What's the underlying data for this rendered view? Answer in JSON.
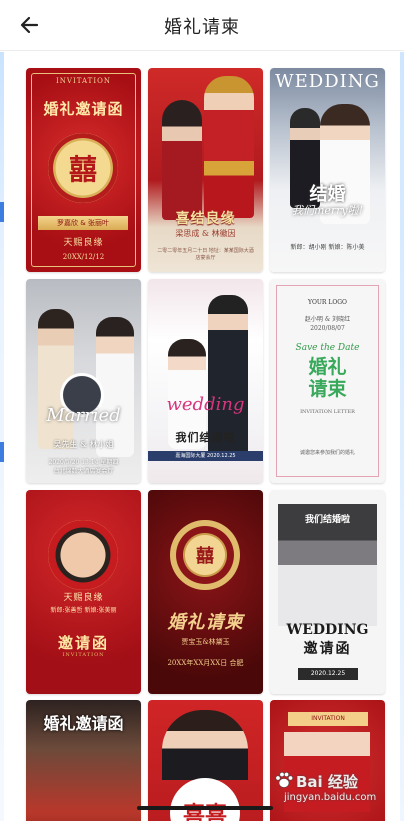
{
  "header": {
    "title": "婚礼请柬",
    "back_icon": "arrow-left-icon"
  },
  "colors": {
    "primary_red": "#b01a1e",
    "gold": "#f3d08d",
    "green": "#38a85a"
  },
  "cards": [
    {
      "invitation": "INVITATION",
      "title": "婚礼邀请函",
      "emblem": "囍",
      "names": "罗嘉欣 & 张丽叶",
      "phrase": "天赐良缘",
      "date": "20XX/12/12"
    },
    {
      "title": "喜结良缘",
      "names": "梁思成 & 林徽因",
      "details": "二零二零年五月二十日 地址：某某国际大酒店宴会厅"
    },
    {
      "title": "WEDDING",
      "subtitle_cn": "结婚",
      "subtitle_en": "我们merry啦!",
      "footer": "新郎：胡小刚   新娘：陈小美"
    },
    {
      "script": "Married",
      "names": "吴先生 & 林小姐",
      "date": "2020/5/20 13:14 星期四",
      "venue": "台北锦数大酒店宴会厅"
    },
    {
      "script": "wedding",
      "title": "我们结婚啦",
      "footer": "嘉海国际大厦  2020.12.25"
    },
    {
      "logo": "YOUR LOGO",
      "names": "赵小明 & 刘晓红",
      "date": "2020/08/07",
      "script": "Save the Date",
      "title": "婚礼请束",
      "caption": "INVITATION LETTER",
      "footer": "诚邀您来参加我们的婚礼"
    },
    {
      "phrase": "天赐良缘",
      "names": "新郎:张善哲 新娘:张美丽",
      "title": "邀请函",
      "caption": "INVITATION"
    },
    {
      "emblem": "囍",
      "title": "婚礼请柬",
      "names": "贾宝玉&林黛玉",
      "details": "20XX年XX月XX日 合肥"
    },
    {
      "header": "我们结婚啦",
      "title": "WEDDING",
      "subtitle": "邀请函",
      "date": "2020.12.25"
    },
    {
      "title": "婚礼邀请函"
    },
    {
      "emblem": "喜喜"
    },
    {
      "invitation": "INVITATION"
    }
  ],
  "watermark": {
    "brand": "Bai 经验",
    "url": "jingyan.baidu.com"
  }
}
